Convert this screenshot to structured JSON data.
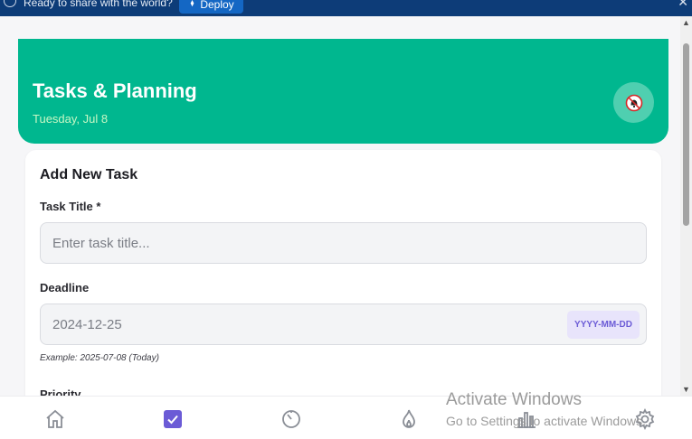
{
  "deploy_bar": {
    "message": "Ready to share with the world?",
    "deploy_label": "Deploy"
  },
  "header": {
    "title": "Tasks & Planning",
    "date": "Tuesday, Jul 8"
  },
  "form": {
    "title": "Add New Task",
    "task_title_label": "Task Title *",
    "task_title_placeholder": "Enter task title...",
    "deadline_label": "Deadline",
    "deadline_value": "2024-12-25",
    "deadline_format": "YYYY-MM-DD",
    "deadline_hint": "Example: 2025-07-08 (Today)",
    "priority_label": "Priority"
  },
  "nav": {
    "items": [
      "home-icon",
      "tasks-checkbox-icon",
      "timer-icon",
      "flame-icon",
      "bar-chart-icon",
      "settings-gear-icon"
    ],
    "active": "tasks-checkbox-icon"
  },
  "watermark": {
    "title": "Activate Windows",
    "subtitle": "Go to Settings to activate Windows."
  },
  "colors": {
    "header_bg": "#00b78f",
    "accent": "#6b5bd6",
    "deploy_bar": "#0d3c78"
  }
}
